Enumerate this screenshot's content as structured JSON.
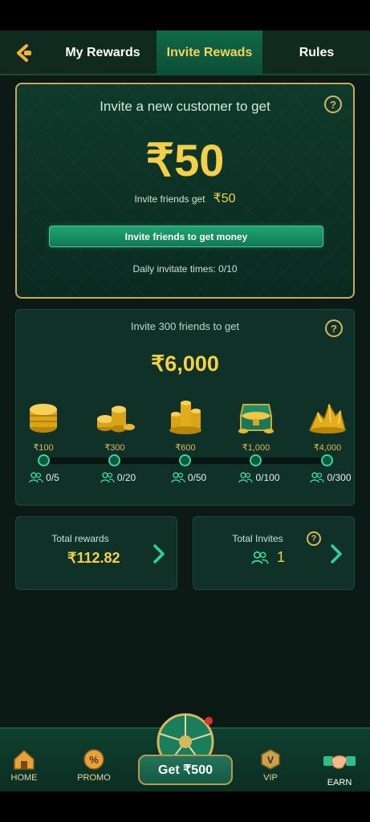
{
  "tabs": {
    "my_rewards": "My Rewards",
    "invite_rewards": "Invite Rewads",
    "rules": "Rules"
  },
  "invite_card": {
    "title": "Invite a new customer to get",
    "amount": "₹50",
    "friends_get_label": "Invite friends get",
    "friends_get_amount": "₹50",
    "button_label": "Invite friends to get money",
    "daily_label": "Daily invitate times:",
    "daily_value": "0/10"
  },
  "milestone_card": {
    "title": "Invite 300 friends to get",
    "amount": "₹6,000",
    "tiers": [
      {
        "prize": "₹100",
        "count": "0/5",
        "icon": "coin-stack-icon"
      },
      {
        "prize": "₹300",
        "count": "0/20",
        "icon": "coin-pile-icon"
      },
      {
        "prize": "₹600",
        "count": "0/50",
        "icon": "coin-heap-icon"
      },
      {
        "prize": "₹1,000",
        "count": "0/100",
        "icon": "treasure-chest-icon"
      },
      {
        "prize": "₹4,000",
        "count": "0/300",
        "icon": "gold-mountain-icon"
      }
    ],
    "progress": 0
  },
  "summary": {
    "total_rewards_label": "Total rewards",
    "total_rewards_value": "₹112.82",
    "total_invites_label": "Total Invites",
    "total_invites_value": "1"
  },
  "nav": {
    "home": "HOME",
    "promo": "PROMO",
    "center": "Get ₹500",
    "vip": "VIP",
    "earn": "EARN"
  },
  "colors": {
    "accent_gold": "#f3d048",
    "accent_green": "#1fa475",
    "background": "#0b1a14"
  }
}
